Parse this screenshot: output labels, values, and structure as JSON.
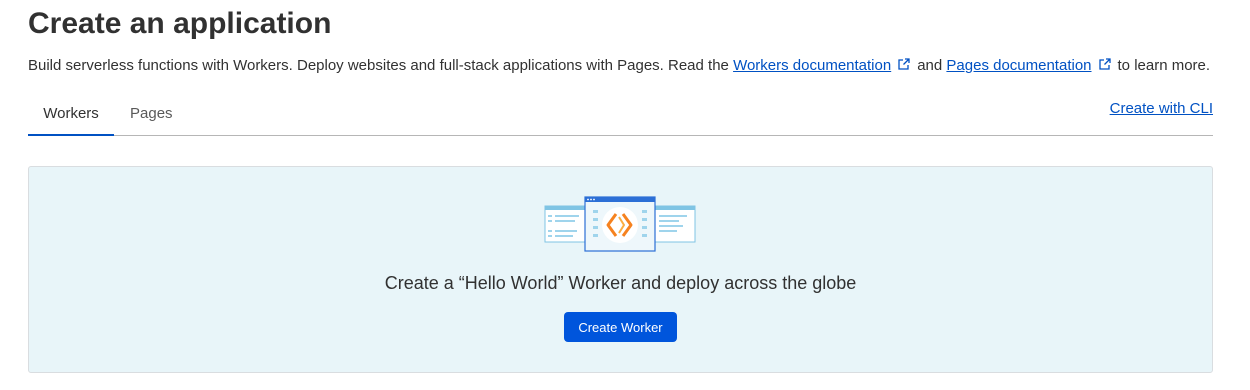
{
  "header": {
    "title": "Create an application",
    "subtitle_prefix": "Build serverless functions with Workers. Deploy websites and full-stack applications with Pages. Read the ",
    "workers_doc_link": "Workers documentation",
    "and_text": "and ",
    "pages_doc_link": "Pages documentation",
    "subtitle_suffix": "to learn more."
  },
  "tabs": [
    {
      "label": "Workers",
      "active": true
    },
    {
      "label": "Pages",
      "active": false
    }
  ],
  "cli_link": "Create with CLI",
  "panel": {
    "heading": "Create a “Hello World” Worker and deploy across the globe",
    "button_label": "Create Worker"
  },
  "colors": {
    "link": "#0051c3",
    "primary_button": "#0055dc",
    "panel_bg": "#e8f5f9",
    "accent_orange": "#f6821f"
  },
  "icons": {
    "external_link": "external-link-icon",
    "illustration": "workers-illustration"
  }
}
